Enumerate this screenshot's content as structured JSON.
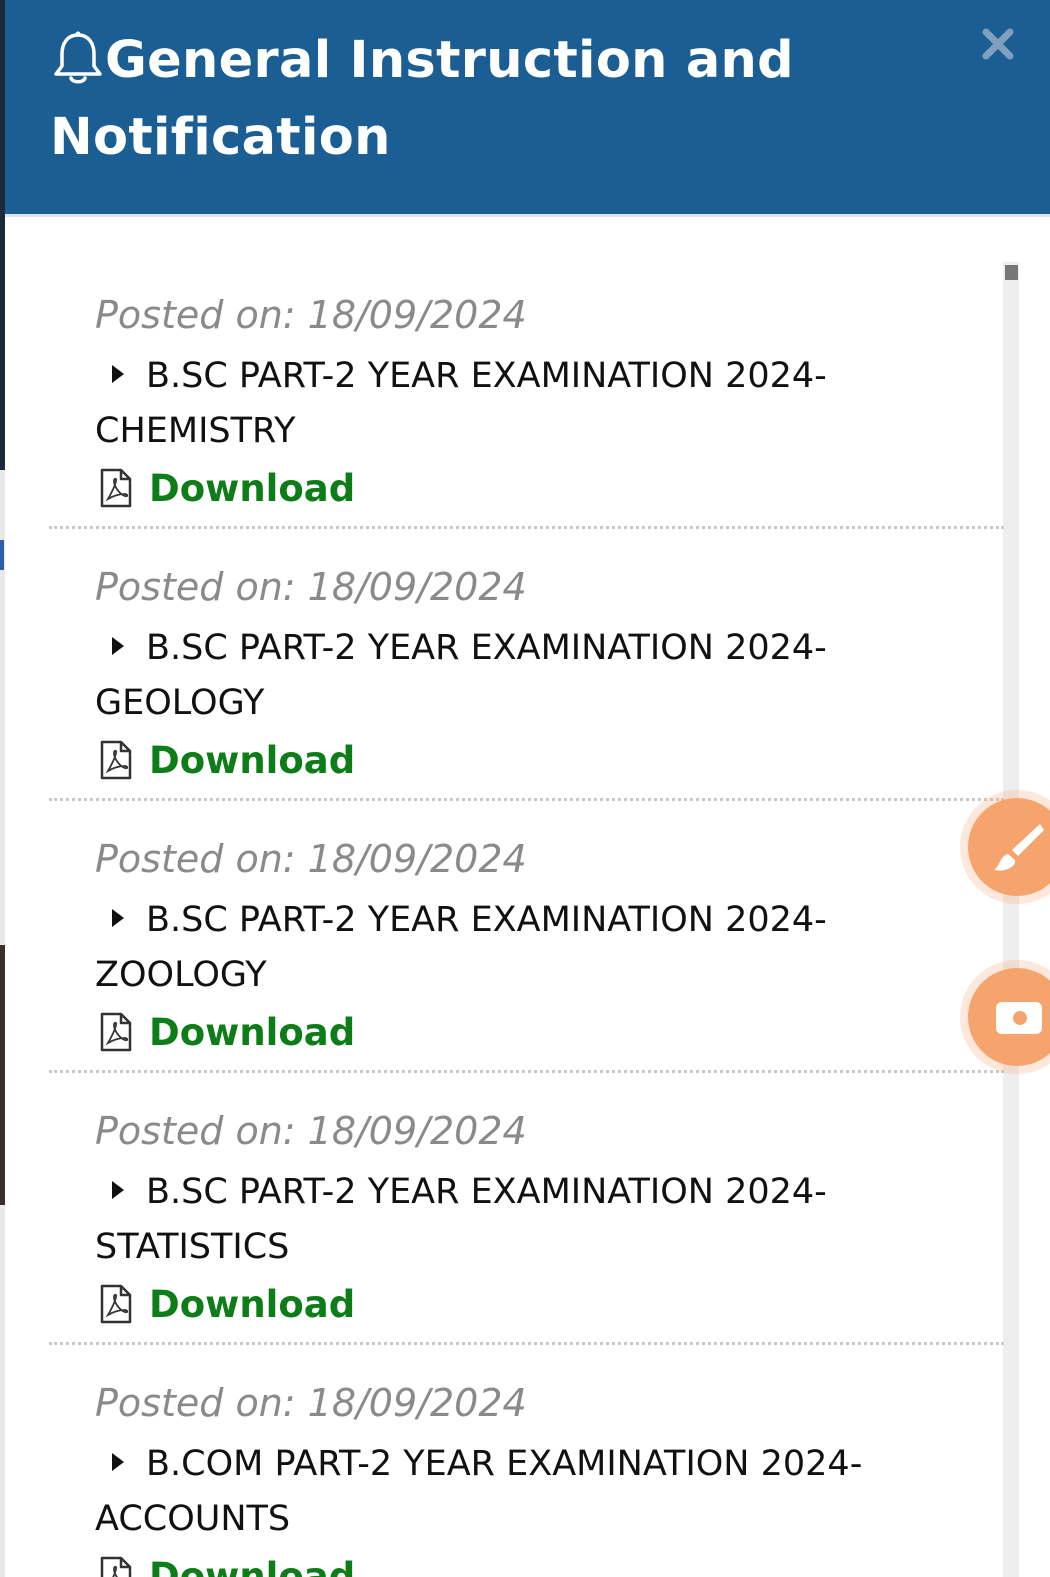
{
  "modal": {
    "title": "General Instruction and Notification",
    "icons": {
      "title": "bell-icon",
      "close": "close-icon",
      "item_bullet": "caret-right-icon",
      "attachment": "pdf-file-icon"
    },
    "colors": {
      "header_bg": "#1b5e93",
      "download_link": "#0d7d18",
      "posted_text": "#8a8a8a",
      "floating_buttons": "#f6a46e"
    }
  },
  "notices": [
    {
      "posted": "Posted on: 18/09/2024",
      "title": "B.SC PART-2 YEAR EXAMINATION 2024-CHEMISTRY",
      "download": "Download"
    },
    {
      "posted": "Posted on: 18/09/2024",
      "title": "B.SC PART-2 YEAR EXAMINATION 2024-GEOLOGY",
      "download": "Download"
    },
    {
      "posted": "Posted on: 18/09/2024",
      "title": "B.SC PART-2 YEAR EXAMINATION 2024-ZOOLOGY",
      "download": "Download"
    },
    {
      "posted": "Posted on: 18/09/2024",
      "title": "B.SC PART-2 YEAR EXAMINATION 2024-STATISTICS",
      "download": "Download"
    },
    {
      "posted": "Posted on: 18/09/2024",
      "title": "B.COM PART-2 YEAR EXAMINATION 2024-ACCOUNTS",
      "download": "Download"
    }
  ],
  "floating_buttons": [
    {
      "icon": "paint-brush-icon"
    },
    {
      "icon": "video-camera-icon"
    }
  ]
}
